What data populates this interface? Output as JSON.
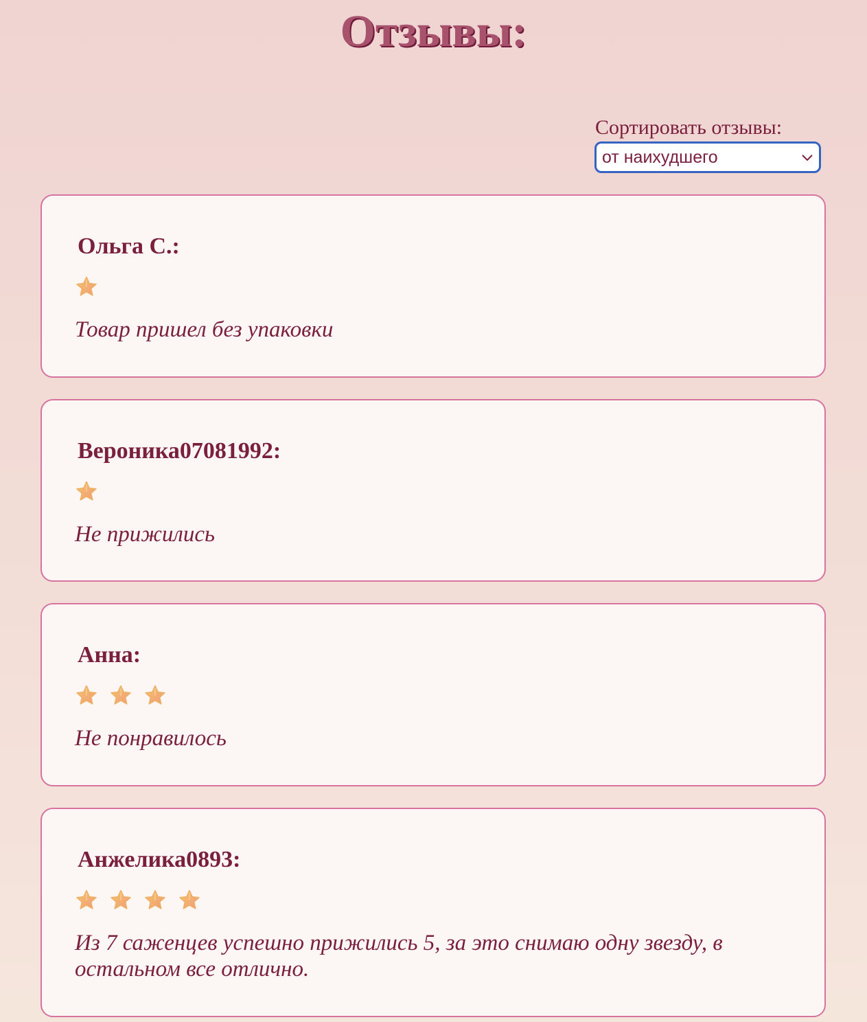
{
  "page": {
    "title": "Отзывы:"
  },
  "sort": {
    "label": "Сортировать отзывы:",
    "selected": "от наихудшего"
  },
  "colors": {
    "accent": "#7a1f3d",
    "card_border": "#d6739f",
    "select_focus": "#3364c4",
    "star": "#f2b36b"
  },
  "reviews": [
    {
      "author": "Ольга С.:",
      "rating": 1,
      "text": "Товар пришел без упаковки"
    },
    {
      "author": "Вероника07081992:",
      "rating": 1,
      "text": "Не прижились"
    },
    {
      "author": "Анна:",
      "rating": 3,
      "text": "Не понравилось"
    },
    {
      "author": "Анжелика0893:",
      "rating": 4,
      "text": "Из 7 саженцев успешно прижились 5, за это снимаю одну звезду, в остальном все отлично."
    }
  ]
}
